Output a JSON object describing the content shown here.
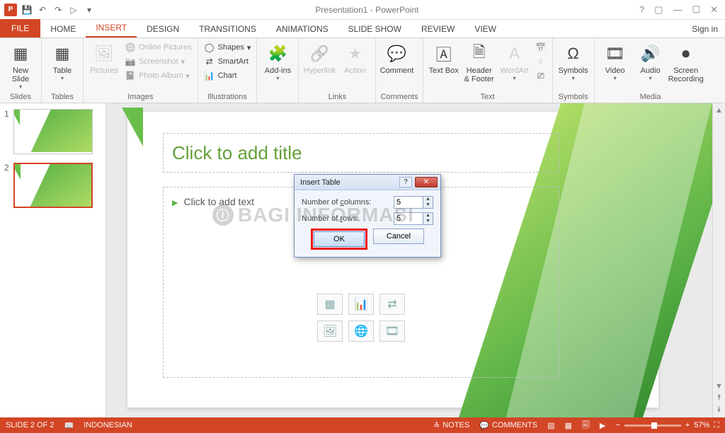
{
  "app": {
    "title": "Presentation1 - PowerPoint",
    "sign_in": "Sign in",
    "icon_letter": "P"
  },
  "qat": {
    "save": "💾",
    "undo": "↶",
    "redo": "↷",
    "start": "▷",
    "more": "▾"
  },
  "tabs": {
    "file": "FILE",
    "home": "HOME",
    "insert": "INSERT",
    "design": "DESIGN",
    "transitions": "TRANSITIONS",
    "animations": "ANIMATIONS",
    "slideshow": "SLIDE SHOW",
    "review": "REVIEW",
    "view": "VIEW"
  },
  "ribbon": {
    "slides": {
      "label": "Slides",
      "new_slide": "New Slide"
    },
    "tables": {
      "label": "Tables",
      "table": "Table"
    },
    "images": {
      "label": "Images",
      "pictures": "Pictures",
      "online": "Online Pictures",
      "screenshot": "Screenshot",
      "album": "Photo Album"
    },
    "illus": {
      "label": "Illustrations",
      "shapes": "Shapes",
      "smartart": "SmartArt",
      "chart": "Chart"
    },
    "addins": {
      "label": " ",
      "addins": "Add-ins"
    },
    "links": {
      "label": "Links",
      "hyperlink": "Hyperlink",
      "action": "Action"
    },
    "comments": {
      "label": "Comments",
      "comment": "Comment"
    },
    "text": {
      "label": "Text",
      "textbox": "Text Box",
      "header": "Header & Footer",
      "wordart": "WordArt"
    },
    "symbols": {
      "label": "Symbols",
      "symbols": "Symbols"
    },
    "media": {
      "label": "Media",
      "video": "Video",
      "audio": "Audio",
      "screenrec": "Screen Recording"
    }
  },
  "thumbs": {
    "n1": "1",
    "n2": "2"
  },
  "slide": {
    "title_ph": "Click to add title",
    "content_ph": "Click to add text"
  },
  "dialog": {
    "title": "Insert Table",
    "cols_label_pre": "Number of ",
    "cols_label_u": "c",
    "cols_label_post": "olumns:",
    "rows_label_pre": "Number of ",
    "rows_label_u": "r",
    "rows_label_post": "ows:",
    "cols_val": "5",
    "rows_val": "5",
    "ok": "OK",
    "cancel": "Cancel"
  },
  "status": {
    "slide": "SLIDE 2 OF 2",
    "lang": "INDONESIAN",
    "notes": "NOTES",
    "comments": "COMMENTS",
    "zoom_pct": "57%"
  },
  "watermark": {
    "text": "BAGI INFORMASI"
  }
}
